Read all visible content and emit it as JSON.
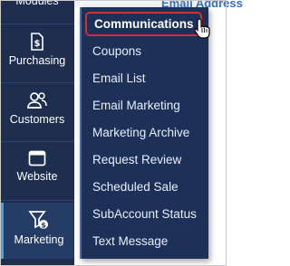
{
  "sidebar": {
    "items": [
      {
        "label": "Modules",
        "icon": "modules-icon"
      },
      {
        "label": "Purchasing",
        "icon": "dollar-document-icon"
      },
      {
        "label": "Customers",
        "icon": "users-icon"
      },
      {
        "label": "Website",
        "icon": "browser-window-icon"
      },
      {
        "label": "Marketing",
        "icon": "marketing-funnel-icon",
        "active": true
      }
    ]
  },
  "background": {
    "title": "Email Address"
  },
  "flyout": {
    "items": [
      {
        "label": "Communications",
        "highlighted": true
      },
      {
        "label": "Coupons"
      },
      {
        "label": "Email List"
      },
      {
        "label": "Email Marketing"
      },
      {
        "label": "Marketing Archive"
      },
      {
        "label": "Request Review"
      },
      {
        "label": "Scheduled Sale"
      },
      {
        "label": "SubAccount Status"
      },
      {
        "label": "Text Message"
      }
    ]
  },
  "colors": {
    "sidebar_bg": "#1d2e4f",
    "flyout_bg": "#1d3158",
    "active_accent": "#3fa7e0",
    "highlight_border": "#d32f2f"
  }
}
